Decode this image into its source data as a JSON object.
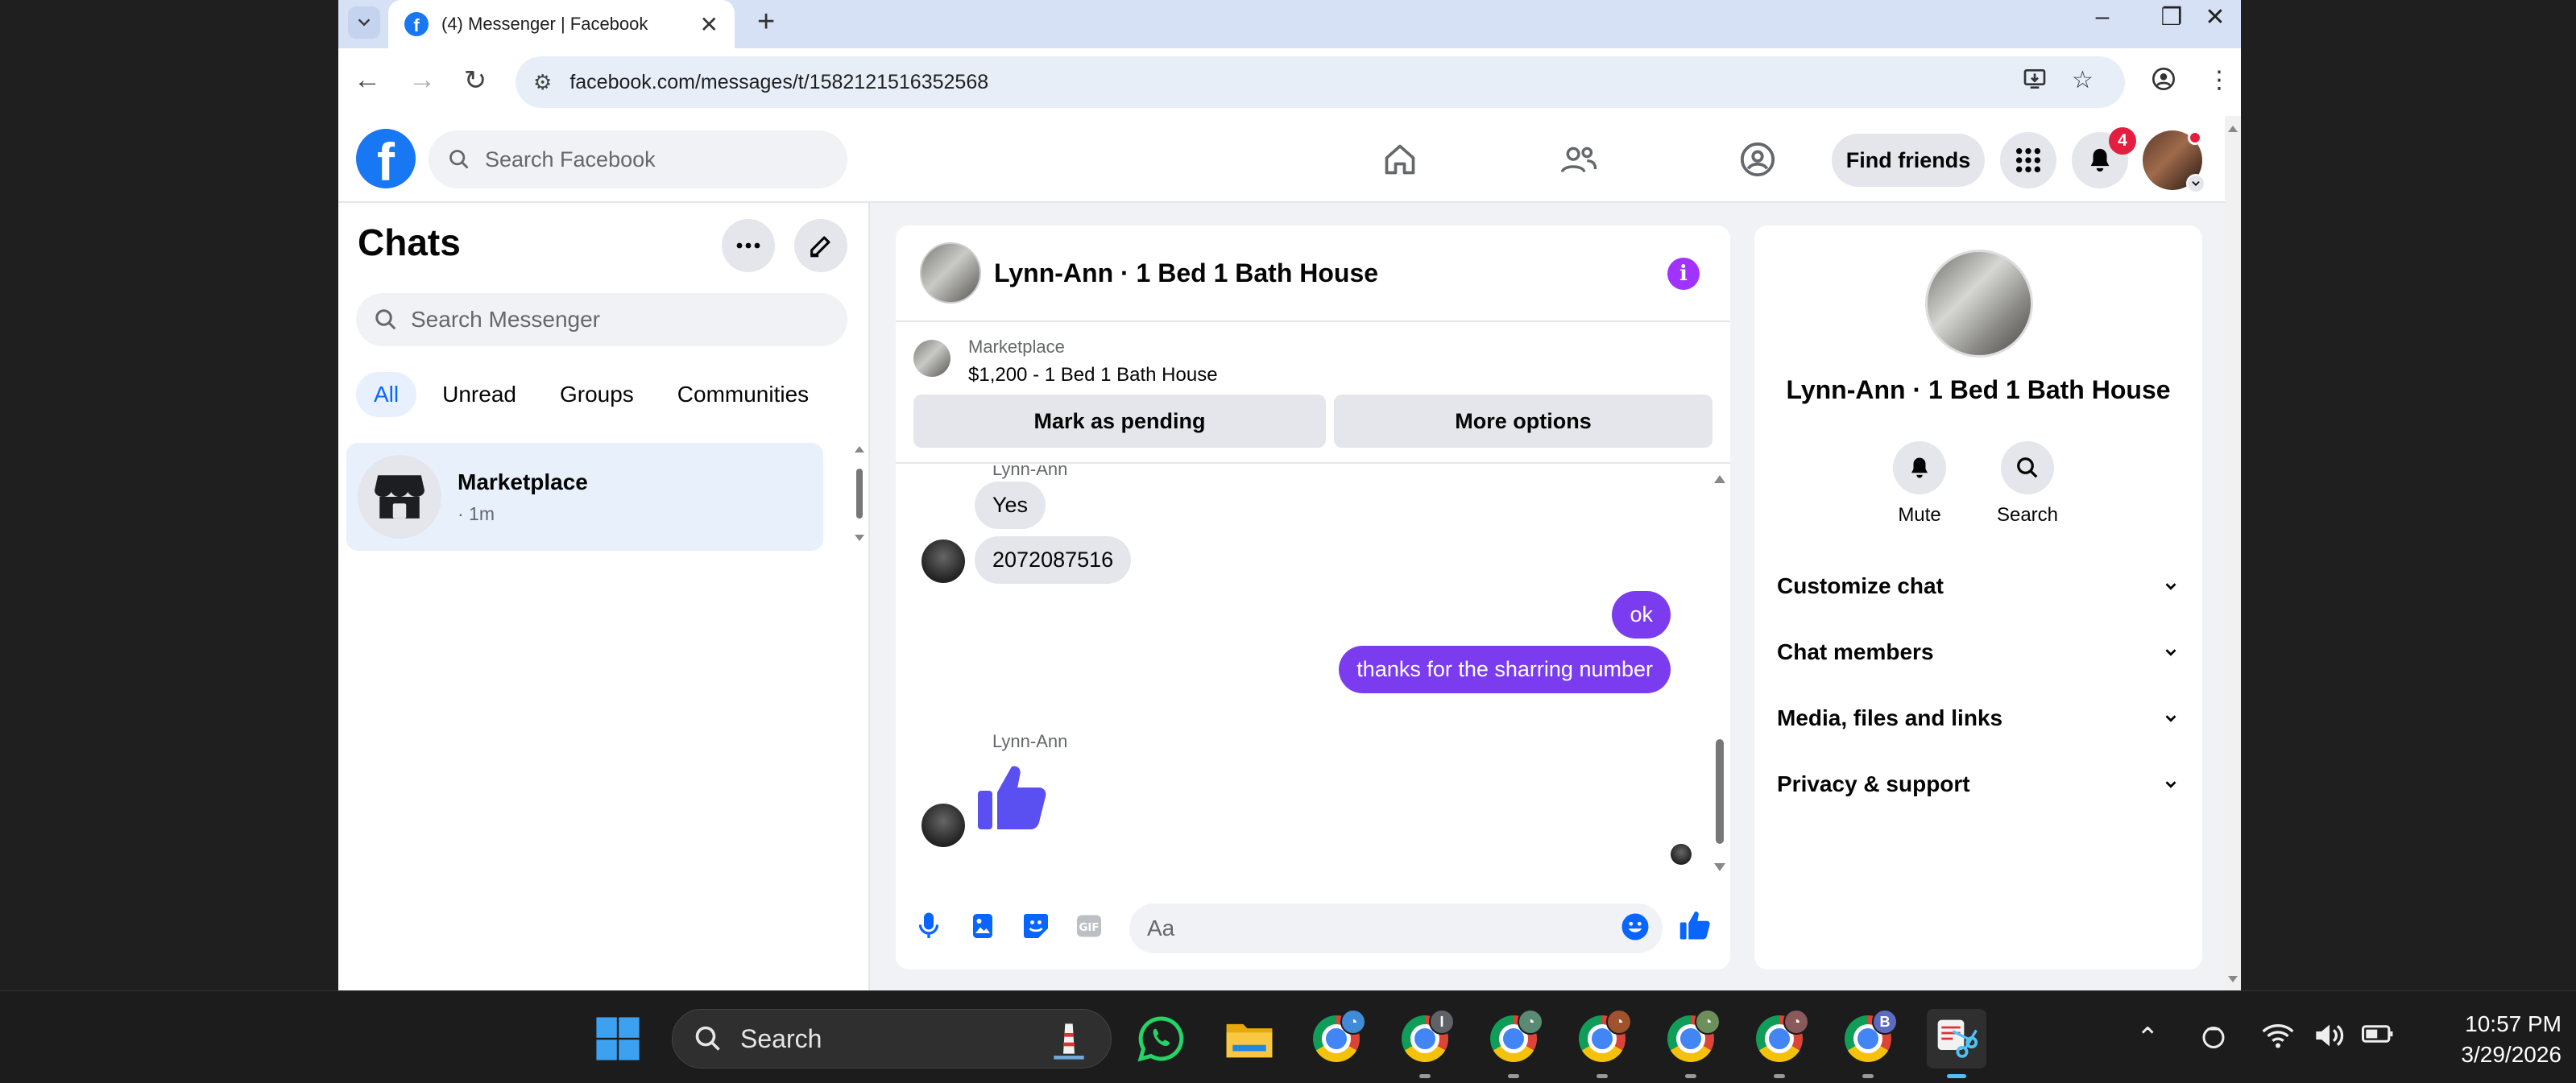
{
  "browser": {
    "tab_title": "(4) Messenger | Facebook",
    "url": "facebook.com/messages/t/1582121516352568"
  },
  "fb_header": {
    "search_placeholder": "Search Facebook",
    "find_friends": "Find friends",
    "notification_count": "4"
  },
  "sidebar": {
    "title": "Chats",
    "search_placeholder": "Search Messenger",
    "filters": [
      "All",
      "Unread",
      "Groups",
      "Communities"
    ],
    "active_filter": "All",
    "chats": [
      {
        "name": "Marketplace",
        "meta": "· 1m"
      }
    ]
  },
  "chat": {
    "title": "Lynn-Ann · 1 Bed 1 Bath House",
    "marketplace_label": "Marketplace",
    "listing": "$1,200 - 1 Bed 1 Bath House",
    "mark_pending": "Mark as pending",
    "more_options": "More options",
    "messages": [
      {
        "sender": "Lynn-Ann",
        "text": "Yes"
      },
      {
        "text": "2072087516"
      },
      {
        "outgoing": true,
        "text": "ok"
      },
      {
        "outgoing": true,
        "text": "thanks for the sharring number"
      },
      {
        "sender": "Lynn-Ann",
        "sticker": "thumbs-up"
      }
    ],
    "composer_placeholder": "Aa"
  },
  "info_panel": {
    "name": "Lynn-Ann · 1 Bed 1 Bath House",
    "mute": "Mute",
    "search": "Search",
    "sections": [
      "Customize chat",
      "Chat members",
      "Media, files and links",
      "Privacy & support"
    ]
  },
  "taskbar": {
    "search_label": "Search",
    "time": "10:57 PM",
    "date": "3/29/2026",
    "chrome_profiles": [
      "",
      "I",
      "",
      "",
      "",
      "",
      "B"
    ]
  },
  "colors": {
    "fb_blue": "#1877f2",
    "messenger_purple": "#7b3cf0",
    "info_purple": "#a033ff",
    "badge_red": "#e41e3f"
  }
}
